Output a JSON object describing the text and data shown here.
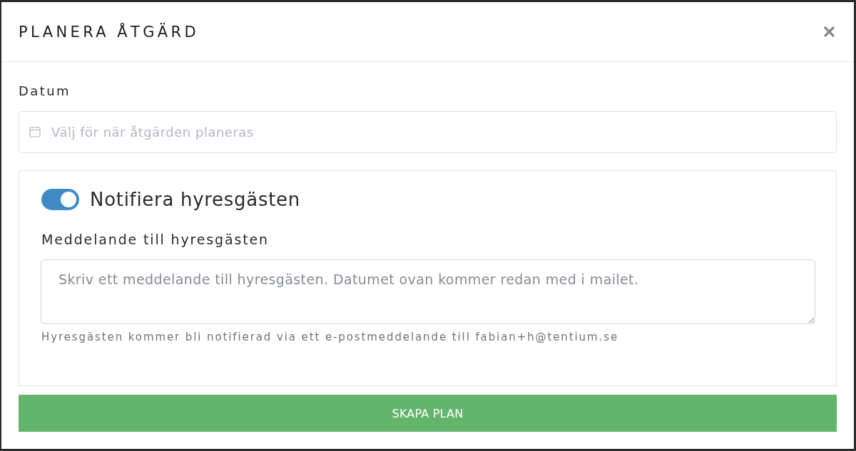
{
  "modal": {
    "title": "PLANERA ÅTGÄRD"
  },
  "date_field": {
    "label": "Datum",
    "placeholder": "Välj för när åtgärden planeras"
  },
  "notify_panel": {
    "toggle": {
      "label": "Notifiera hyresgästen",
      "on": true
    },
    "message": {
      "label": "Meddelande till hyresgästen",
      "placeholder": "Skriv ett meddelande till hyresgästen. Datumet ovan kommer redan med i mailet."
    },
    "hint": "Hyresgästen kommer bli notifierad via ett e-postmeddelande till fabian+h@tentium.se"
  },
  "submit_button": {
    "label": "SKAPA PLAN"
  }
}
